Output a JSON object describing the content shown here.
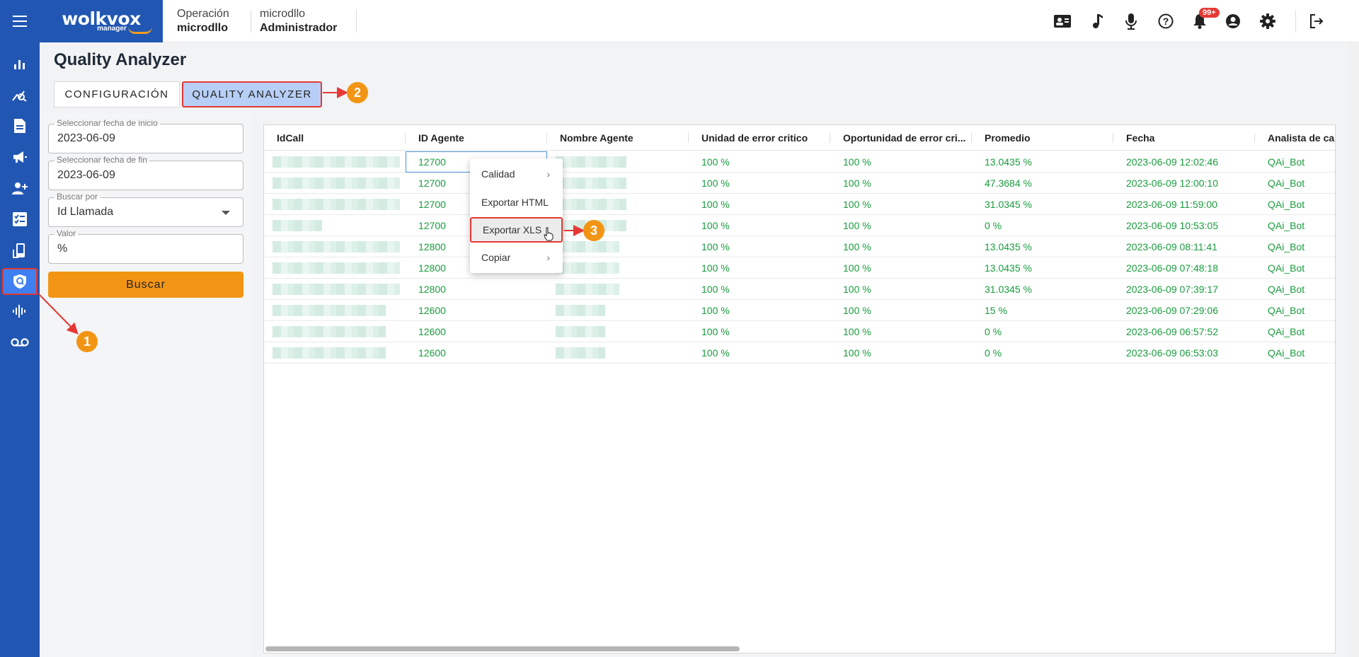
{
  "header": {
    "brand": "wolkvox",
    "brand_sub": "manager",
    "operation_label": "Operación",
    "operation_value": "microdllo",
    "user_name": "microdllo",
    "user_role": "Administrador",
    "notification_count": "99+"
  },
  "topbar_icons": [
    "contact-card-icon",
    "music-note-icon",
    "microphone-icon",
    "help-icon",
    "bell-icon",
    "user-icon",
    "gear-icon",
    "logout-icon"
  ],
  "sidebar_icons": [
    "bar-chart-icon",
    "analytics-icon",
    "report-icon",
    "campaign-icon",
    "add-user-icon",
    "checklist-icon",
    "phone-device-icon",
    "quality-shield-icon",
    "audio-wave-icon",
    "voicemail-icon"
  ],
  "page": {
    "title": "Quality Analyzer",
    "tabs": [
      {
        "label": "CONFIGURACIÓN",
        "active": false
      },
      {
        "label": "QUALITY ANALYZER",
        "active": true
      }
    ]
  },
  "filters": {
    "start_date": {
      "label": "Seleccionar fecha de inicio",
      "value": "2023-06-09"
    },
    "end_date": {
      "label": "Seleccionar fecha de fin",
      "value": "2023-06-09"
    },
    "search_by": {
      "label": "Buscar por",
      "value": "Id Llamada"
    },
    "value": {
      "label": "Valor",
      "value": "%"
    },
    "search_button": "Buscar"
  },
  "grid": {
    "columns": [
      "IdCall",
      "ID Agente",
      "Nombre Agente",
      "Unidad de error critico",
      "Oportunidad de error cri...",
      "Promedio",
      "Fecha",
      "Analista de calid"
    ],
    "rows": [
      {
        "agent_id": "12700",
        "critical_unit": "100 %",
        "critical_opportunity": "100 %",
        "average": "13.0435 %",
        "date": "2023-06-09 12:02:46",
        "analyst": "QAi_Bot"
      },
      {
        "agent_id": "12700",
        "critical_unit": "100 %",
        "critical_opportunity": "100 %",
        "average": "47.3684 %",
        "date": "2023-06-09 12:00:10",
        "analyst": "QAi_Bot"
      },
      {
        "agent_id": "12700",
        "critical_unit": "100 %",
        "critical_opportunity": "100 %",
        "average": "31.0345 %",
        "date": "2023-06-09 11:59:00",
        "analyst": "QAi_Bot"
      },
      {
        "agent_id": "12700",
        "critical_unit": "100 %",
        "critical_opportunity": "100 %",
        "average": "0 %",
        "date": "2023-06-09 10:53:05",
        "analyst": "QAi_Bot"
      },
      {
        "agent_id": "12800",
        "critical_unit": "100 %",
        "critical_opportunity": "100 %",
        "average": "13.0435 %",
        "date": "2023-06-09 08:11:41",
        "analyst": "QAi_Bot"
      },
      {
        "agent_id": "12800",
        "critical_unit": "100 %",
        "critical_opportunity": "100 %",
        "average": "13.0435 %",
        "date": "2023-06-09 07:48:18",
        "analyst": "QAi_Bot"
      },
      {
        "agent_id": "12800",
        "critical_unit": "100 %",
        "critical_opportunity": "100 %",
        "average": "31.0345 %",
        "date": "2023-06-09 07:39:17",
        "analyst": "QAi_Bot"
      },
      {
        "agent_id": "12600",
        "critical_unit": "100 %",
        "critical_opportunity": "100 %",
        "average": "15 %",
        "date": "2023-06-09 07:29:06",
        "analyst": "QAi_Bot"
      },
      {
        "agent_id": "12600",
        "critical_unit": "100 %",
        "critical_opportunity": "100 %",
        "average": "0 %",
        "date": "2023-06-09 06:57:52",
        "analyst": "QAi_Bot"
      },
      {
        "agent_id": "12600",
        "critical_unit": "100 %",
        "critical_opportunity": "100 %",
        "average": "0 %",
        "date": "2023-06-09 06:53:03",
        "analyst": "QAi_Bot"
      }
    ]
  },
  "context_menu": {
    "items": [
      {
        "label": "Calidad",
        "submenu": true
      },
      {
        "label": "Exportar HTML",
        "submenu": false
      },
      {
        "label": "Exportar XLS",
        "submenu": false
      },
      {
        "label": "Copiar",
        "submenu": true
      }
    ]
  },
  "annotations": [
    "1",
    "2",
    "3"
  ],
  "colors": {
    "primary_blue": "#2157b3",
    "accent_orange": "#f39514",
    "highlight_red": "#e53935",
    "data_green": "#1a9c3e"
  }
}
